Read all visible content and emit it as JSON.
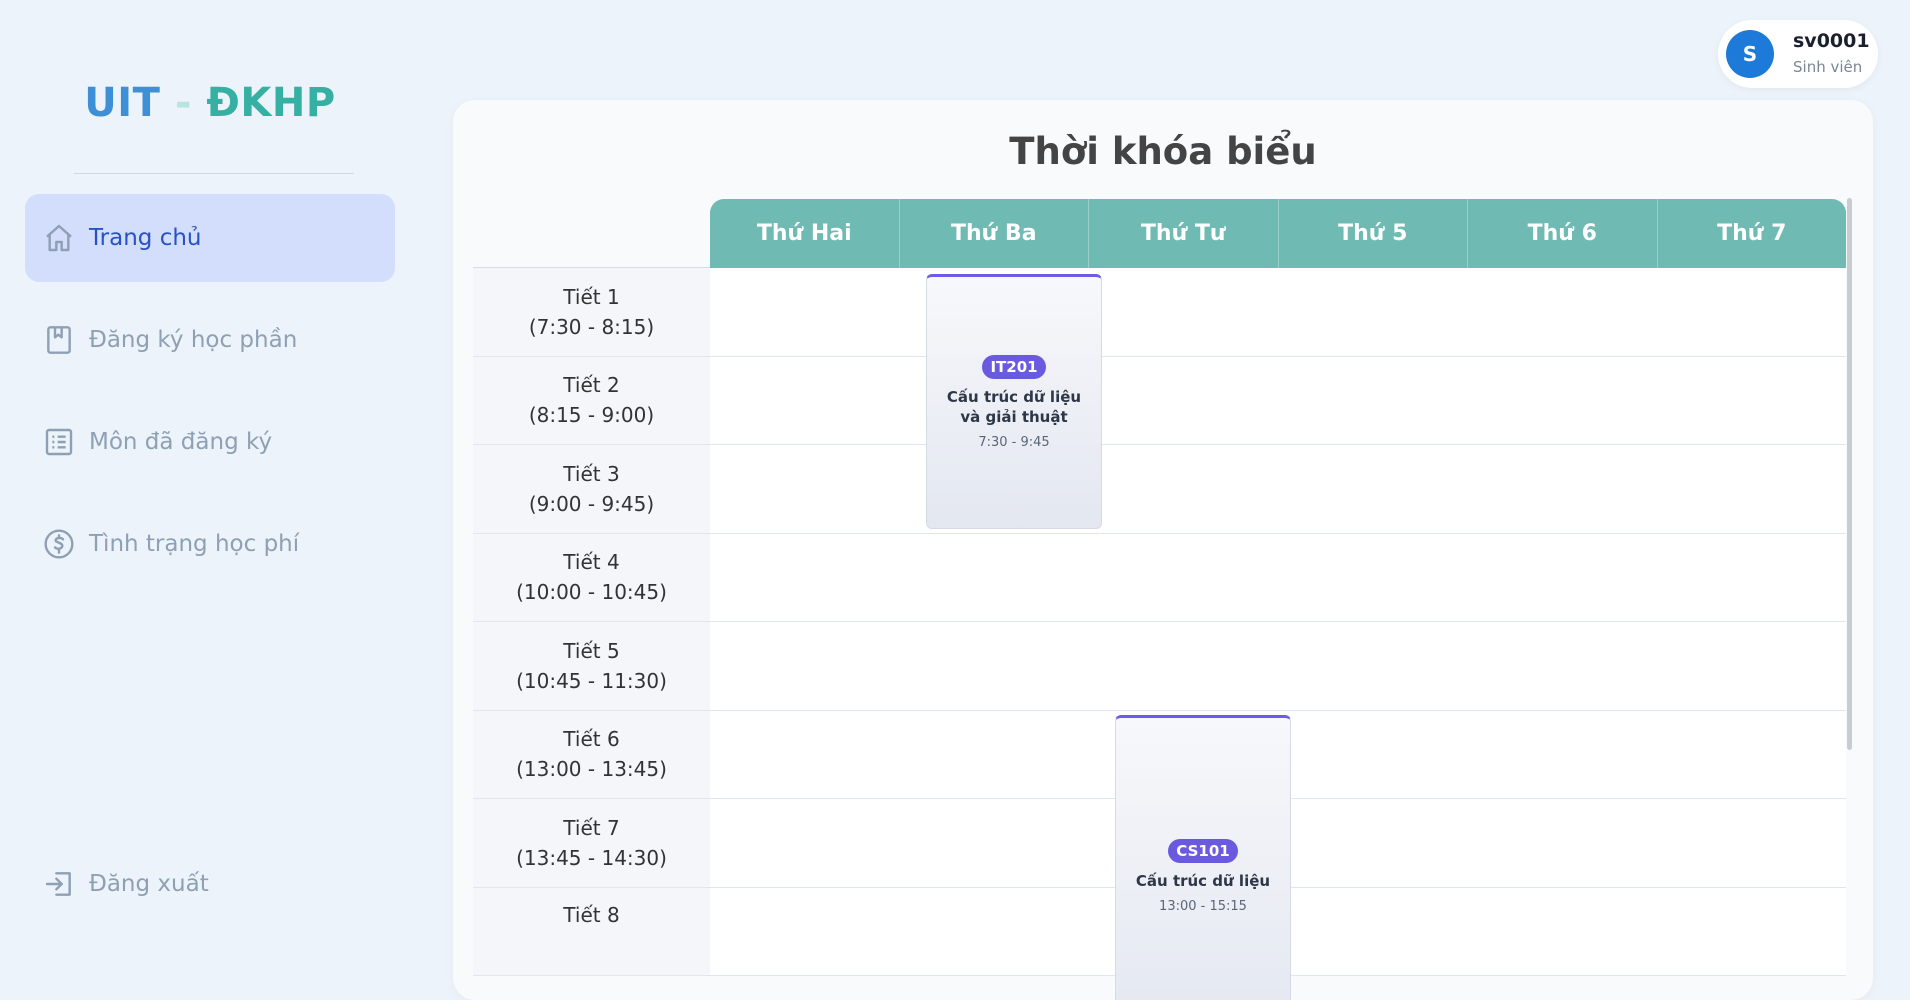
{
  "logo": {
    "part1": "UIT",
    "sep": "-",
    "part2": "ĐKHP"
  },
  "nav": {
    "home": "Trang chủ",
    "register": "Đăng ký học phần",
    "registered": "Môn đã đăng ký",
    "tuition": "Tình trạng học phí",
    "logout": "Đăng xuất"
  },
  "user": {
    "initial": "S",
    "name": "sv0001",
    "role": "Sinh viên"
  },
  "timetable": {
    "title": "Thời khóa biểu",
    "days": [
      "Thứ Hai",
      "Thứ Ba",
      "Thứ Tư",
      "Thứ 5",
      "Thứ 6",
      "Thứ 7"
    ],
    "periods": [
      {
        "name": "Tiết 1",
        "time": "(7:30 - 8:15)"
      },
      {
        "name": "Tiết 2",
        "time": "(8:15 - 9:00)"
      },
      {
        "name": "Tiết 3",
        "time": "(9:00 - 9:45)"
      },
      {
        "name": "Tiết 4",
        "time": "(10:00 - 10:45)"
      },
      {
        "name": "Tiết 5",
        "time": "(10:45 - 11:30)"
      },
      {
        "name": "Tiết 6",
        "time": "(13:00 - 13:45)"
      },
      {
        "name": "Tiết 7",
        "time": "(13:45 - 14:30)"
      },
      {
        "name": "Tiết 8",
        "time": ""
      }
    ],
    "courses": [
      {
        "code": "IT201",
        "name": "Cấu trúc dữ liệu và giải thuật",
        "time": "7:30 - 9:45",
        "day": "Thứ Ba"
      },
      {
        "code": "CS101",
        "name": "Cấu trúc dữ liệu",
        "time": "13:00 - 15:15",
        "day": "Thứ Tư"
      }
    ]
  },
  "colors": {
    "header": "#6fbab2",
    "active_nav": "#d3defd",
    "course_accent": "#6a5ae0",
    "avatar": "#1e7ad8"
  }
}
